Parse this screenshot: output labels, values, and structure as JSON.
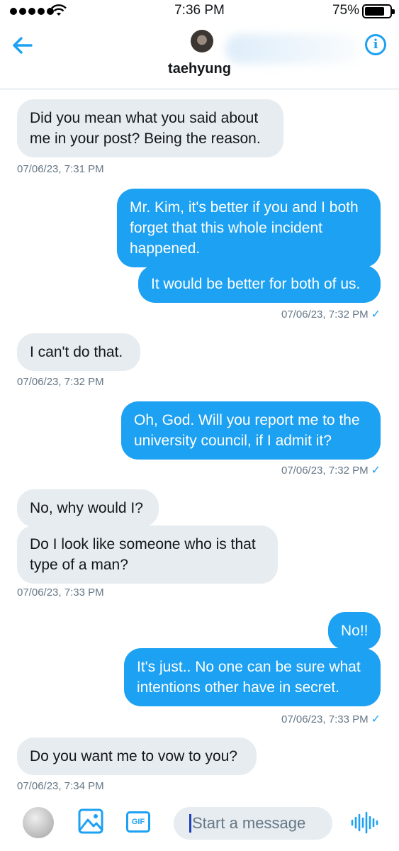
{
  "status_bar": {
    "time": "7:36 PM",
    "battery_percent": "75%",
    "signal_bars": 5,
    "battery_level": 0.75
  },
  "header": {
    "back_icon": "back-arrow-icon",
    "info_icon": "info-icon",
    "contact_name": "taehyung"
  },
  "messages": [
    {
      "direction": "in",
      "text": "Did you mean what you said about me in your post? Being the reason."
    },
    {
      "direction": "in",
      "timestamp": "07/06/23, 7:31 PM"
    },
    {
      "direction": "out",
      "text": "Mr. Kim, it's better if you and I both forget that this whole incident happened."
    },
    {
      "direction": "out",
      "text": "It would be better for both of us."
    },
    {
      "direction": "out",
      "timestamp": "07/06/23, 7:32 PM",
      "read": true
    },
    {
      "direction": "in",
      "text": "I can't do that."
    },
    {
      "direction": "in",
      "timestamp": "07/06/23, 7:32 PM"
    },
    {
      "direction": "out",
      "text": "Oh, God. Will you report me to the university council, if I admit it?"
    },
    {
      "direction": "out",
      "timestamp": "07/06/23, 7:32 PM",
      "read": true
    },
    {
      "direction": "in",
      "text": "No, why would I?"
    },
    {
      "direction": "in",
      "text": "Do I look like someone who is that type of a man?"
    },
    {
      "direction": "in",
      "timestamp": "07/06/23, 7:33 PM"
    },
    {
      "direction": "out",
      "text": "No!!"
    },
    {
      "direction": "out",
      "text": "It's just.. No one can be sure what intentions other have in secret."
    },
    {
      "direction": "out",
      "timestamp": "07/06/23, 7:33 PM",
      "read": true
    },
    {
      "direction": "in",
      "text": "Do you want me to vow to you?"
    },
    {
      "direction": "in",
      "timestamp": "07/06/23, 7:34 PM"
    }
  ],
  "composer": {
    "placeholder": "Start a message",
    "gif_label": "GIF",
    "image_icon": "image-icon",
    "voice_icon": "voice-waveform-icon"
  },
  "colors": {
    "accent": "#1da1f2",
    "incoming_bubble": "#e6ecf0",
    "timestamp": "#657786"
  }
}
